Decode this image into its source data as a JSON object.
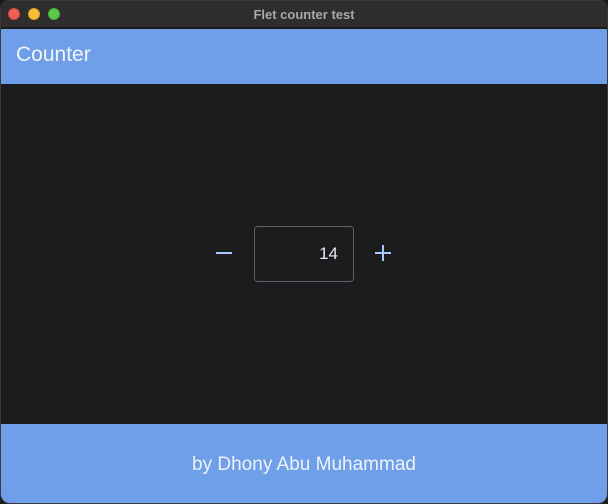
{
  "window": {
    "title": "Flet counter test"
  },
  "appbar": {
    "title": "Counter"
  },
  "counter": {
    "value": "14",
    "decrement_icon": "minus-icon",
    "increment_icon": "plus-icon"
  },
  "footer": {
    "credit": "by Dhony Abu Muhammad"
  },
  "colors": {
    "accent": "#6e9fe8",
    "background": "#1b1c1e",
    "icon": "#a8c7fa"
  }
}
